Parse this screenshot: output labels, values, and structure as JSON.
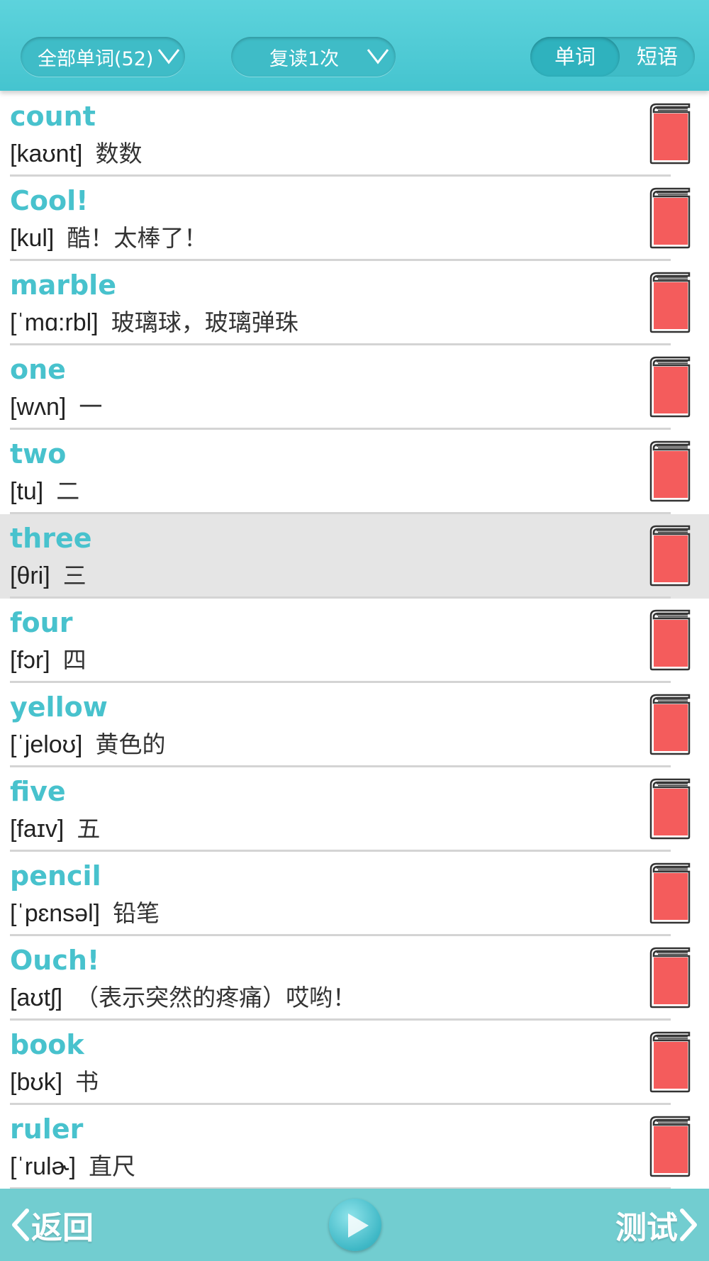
{
  "header": {
    "filter_dropdown": "全部单词(52)",
    "repeat_dropdown": "复读1次",
    "tabs": [
      "单词",
      "短语"
    ],
    "active_tab": "单词"
  },
  "words": [
    {
      "word": "count",
      "phonetic": "[kaʊnt]",
      "meaning": "数数"
    },
    {
      "word": "Cool!",
      "phonetic": "[kul]",
      "meaning": "酷！太棒了！"
    },
    {
      "word": "marble",
      "phonetic": "[ˈmɑ:rbl]",
      "meaning": "玻璃球，玻璃弹珠"
    },
    {
      "word": "one",
      "phonetic": "[wʌn]",
      "meaning": "一"
    },
    {
      "word": "two",
      "phonetic": "[tu]",
      "meaning": "二"
    },
    {
      "word": "three",
      "phonetic": "[θri]",
      "meaning": "三"
    },
    {
      "word": "four",
      "phonetic": "[fɔr]",
      "meaning": "四"
    },
    {
      "word": "yellow",
      "phonetic": "[ˈjeloʊ]",
      "meaning": "黄色的"
    },
    {
      "word": "five",
      "phonetic": "[faɪv]",
      "meaning": "五"
    },
    {
      "word": "pencil",
      "phonetic": "[ˈpɛnsəl]",
      "meaning": "铅笔"
    },
    {
      "word": "Ouch!",
      "phonetic": "[aʊtʃ]",
      "meaning": "（表示突然的疼痛）哎哟！"
    },
    {
      "word": "book",
      "phonetic": "[bʊk]",
      "meaning": "书"
    },
    {
      "word": "ruler",
      "phonetic": "[ˈrulɚ]",
      "meaning": "直尺"
    }
  ],
  "highlighted_word": "three",
  "footer": {
    "back_label": "返回",
    "test_label": "测试"
  },
  "colors": {
    "header_bg": "#4fcbd5",
    "word_text": "#48c2cd",
    "book_red": "#f45c5c",
    "footer_bg": "#72cdd0",
    "highlight_row": "#e5e5e5"
  },
  "icons": [
    "chevron-down-icon",
    "book-icon",
    "back-arrow-icon",
    "play-icon",
    "forward-arrow-icon"
  ]
}
